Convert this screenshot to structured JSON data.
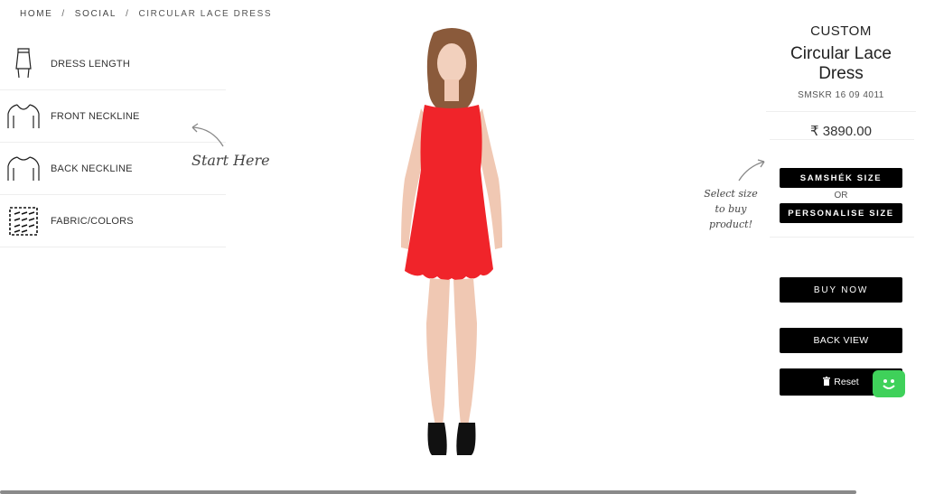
{
  "breadcrumb": {
    "home": "HOME",
    "section": "SOCIAL",
    "current": "CIRCULAR LACE DRESS",
    "separator": "/"
  },
  "options": [
    {
      "label": "DRESS LENGTH",
      "icon": "skirt-icon"
    },
    {
      "label": "FRONT NECKLINE",
      "icon": "neckline-front-icon"
    },
    {
      "label": "BACK NECKLINE",
      "icon": "neckline-back-icon"
    },
    {
      "label": "FABRIC/COLORS",
      "icon": "fabric-icon"
    }
  ],
  "hints": {
    "start": "Start Here",
    "select_size": "Select size to buy product!"
  },
  "product": {
    "category": "CUSTOM",
    "name": "Circular Lace Dress",
    "sku": "SMSKR 16 09 4011",
    "price": "₹ 3890.00",
    "dress_color": "#f0242a"
  },
  "actions": {
    "samshek_size": "SAMSHÉK SIZE",
    "or": "OR",
    "personalise_size": "PERSONALISE SIZE",
    "buy_now": "BUY NOW",
    "back_view": "BACK VIEW",
    "reset": "Reset"
  },
  "colors": {
    "button_bg": "#000000",
    "chat_green": "#3fd15a"
  }
}
